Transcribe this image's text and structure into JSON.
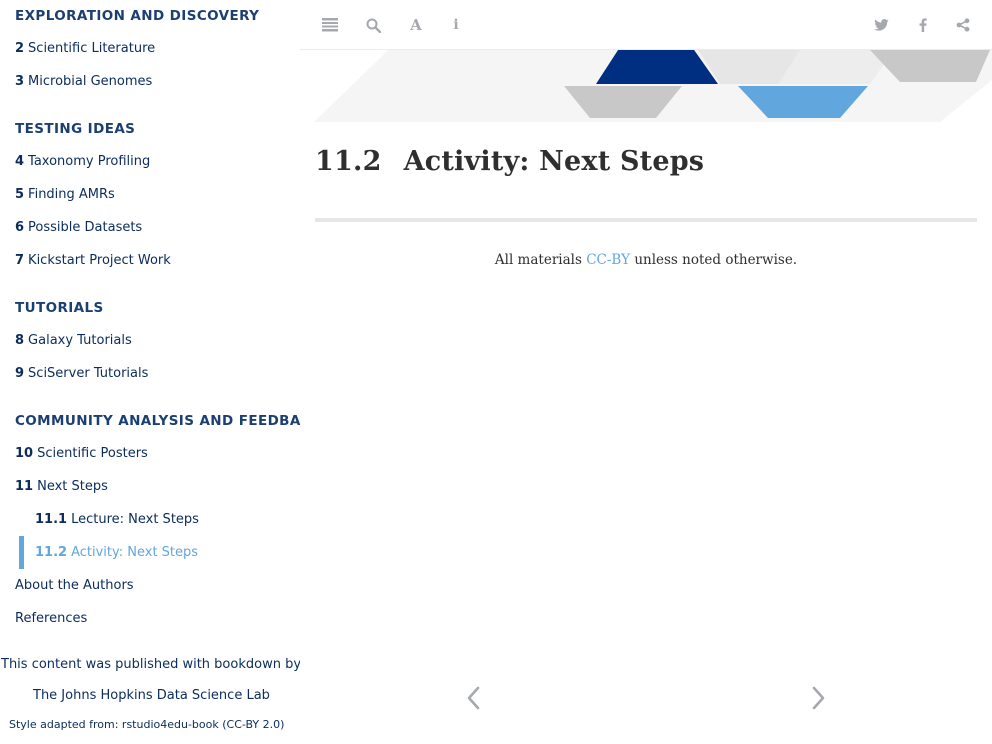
{
  "sidebar": {
    "section_exploration": "Exploration and Discovery",
    "item_2": {
      "num": "2",
      "label": "Scientific Literature"
    },
    "item_3": {
      "num": "3",
      "label": "Microbial Genomes"
    },
    "section_testing": "Testing Ideas",
    "item_4": {
      "num": "4",
      "label": "Taxonomy Profiling"
    },
    "item_5": {
      "num": "5",
      "label": "Finding AMRs"
    },
    "item_6": {
      "num": "6",
      "label": "Possible Datasets"
    },
    "item_7": {
      "num": "7",
      "label": "Kickstart Project Work"
    },
    "section_tutorials": "Tutorials",
    "item_8": {
      "num": "8",
      "label": "Galaxy Tutorials"
    },
    "item_9": {
      "num": "9",
      "label": "SciServer Tutorials"
    },
    "section_community": "Community Analysis and Feedback",
    "item_10": {
      "num": "10",
      "label": "Scientific Posters"
    },
    "item_11": {
      "num": "11",
      "label": "Next Steps"
    },
    "item_11_1": {
      "num": "11.1",
      "label": "Lecture: Next Steps"
    },
    "item_11_2": {
      "num": "11.2",
      "label": "Activity: Next Steps"
    },
    "about": "About the Authors",
    "references": "References",
    "published_with": "This content was published with bookdown by:",
    "publisher": "The Johns Hopkins Data Science Lab",
    "style_adapted": "Style adapted from: rstudio4edu-book (CC-BY 2.0)"
  },
  "toolbar": {
    "icons": [
      "toc-toggle-icon",
      "search-icon",
      "font-settings-icon",
      "info-icon",
      "twitter-icon",
      "facebook-icon",
      "share-icon"
    ]
  },
  "main": {
    "chapter_number": "11.2",
    "chapter_title": "Activity: Next Steps",
    "license_prefix": "All materials",
    "license_link": "CC-BY",
    "license_suffix": "unless noted otherwise."
  },
  "colors": {
    "navy": "#0b2c5c",
    "accent_blue": "#62a6de",
    "dark_blue": "#002e80",
    "light_gray": "#f4f4f4",
    "mid_gray": "#c8c8c8"
  }
}
